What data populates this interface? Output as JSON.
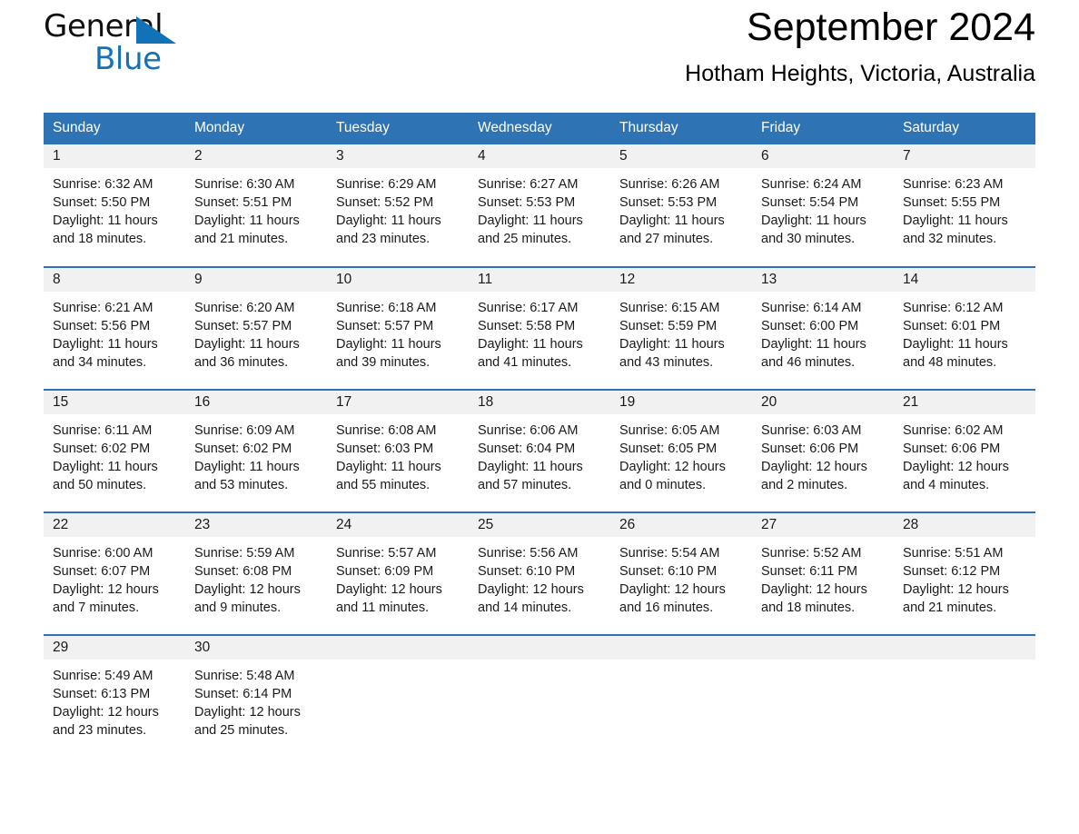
{
  "brand": {
    "name_part1": "General",
    "name_part2": "Blue",
    "triangle_color": "#1272b8"
  },
  "header": {
    "title": "September 2024",
    "location": "Hotham Heights, Victoria, Australia"
  },
  "theme": {
    "header_blue": "#2e74b5",
    "daynum_grey": "#f1f1f1",
    "text": "#1a1a1a"
  },
  "weekday_headers": [
    "Sunday",
    "Monday",
    "Tuesday",
    "Wednesday",
    "Thursday",
    "Friday",
    "Saturday"
  ],
  "weeks": [
    [
      {
        "day": "1",
        "sunrise": "Sunrise: 6:32 AM",
        "sunset": "Sunset: 5:50 PM",
        "daylight_line1": "Daylight: 11 hours",
        "daylight_line2": "and 18 minutes."
      },
      {
        "day": "2",
        "sunrise": "Sunrise: 6:30 AM",
        "sunset": "Sunset: 5:51 PM",
        "daylight_line1": "Daylight: 11 hours",
        "daylight_line2": "and 21 minutes."
      },
      {
        "day": "3",
        "sunrise": "Sunrise: 6:29 AM",
        "sunset": "Sunset: 5:52 PM",
        "daylight_line1": "Daylight: 11 hours",
        "daylight_line2": "and 23 minutes."
      },
      {
        "day": "4",
        "sunrise": "Sunrise: 6:27 AM",
        "sunset": "Sunset: 5:53 PM",
        "daylight_line1": "Daylight: 11 hours",
        "daylight_line2": "and 25 minutes."
      },
      {
        "day": "5",
        "sunrise": "Sunrise: 6:26 AM",
        "sunset": "Sunset: 5:53 PM",
        "daylight_line1": "Daylight: 11 hours",
        "daylight_line2": "and 27 minutes."
      },
      {
        "day": "6",
        "sunrise": "Sunrise: 6:24 AM",
        "sunset": "Sunset: 5:54 PM",
        "daylight_line1": "Daylight: 11 hours",
        "daylight_line2": "and 30 minutes."
      },
      {
        "day": "7",
        "sunrise": "Sunrise: 6:23 AM",
        "sunset": "Sunset: 5:55 PM",
        "daylight_line1": "Daylight: 11 hours",
        "daylight_line2": "and 32 minutes."
      }
    ],
    [
      {
        "day": "8",
        "sunrise": "Sunrise: 6:21 AM",
        "sunset": "Sunset: 5:56 PM",
        "daylight_line1": "Daylight: 11 hours",
        "daylight_line2": "and 34 minutes."
      },
      {
        "day": "9",
        "sunrise": "Sunrise: 6:20 AM",
        "sunset": "Sunset: 5:57 PM",
        "daylight_line1": "Daylight: 11 hours",
        "daylight_line2": "and 36 minutes."
      },
      {
        "day": "10",
        "sunrise": "Sunrise: 6:18 AM",
        "sunset": "Sunset: 5:57 PM",
        "daylight_line1": "Daylight: 11 hours",
        "daylight_line2": "and 39 minutes."
      },
      {
        "day": "11",
        "sunrise": "Sunrise: 6:17 AM",
        "sunset": "Sunset: 5:58 PM",
        "daylight_line1": "Daylight: 11 hours",
        "daylight_line2": "and 41 minutes."
      },
      {
        "day": "12",
        "sunrise": "Sunrise: 6:15 AM",
        "sunset": "Sunset: 5:59 PM",
        "daylight_line1": "Daylight: 11 hours",
        "daylight_line2": "and 43 minutes."
      },
      {
        "day": "13",
        "sunrise": "Sunrise: 6:14 AM",
        "sunset": "Sunset: 6:00 PM",
        "daylight_line1": "Daylight: 11 hours",
        "daylight_line2": "and 46 minutes."
      },
      {
        "day": "14",
        "sunrise": "Sunrise: 6:12 AM",
        "sunset": "Sunset: 6:01 PM",
        "daylight_line1": "Daylight: 11 hours",
        "daylight_line2": "and 48 minutes."
      }
    ],
    [
      {
        "day": "15",
        "sunrise": "Sunrise: 6:11 AM",
        "sunset": "Sunset: 6:02 PM",
        "daylight_line1": "Daylight: 11 hours",
        "daylight_line2": "and 50 minutes."
      },
      {
        "day": "16",
        "sunrise": "Sunrise: 6:09 AM",
        "sunset": "Sunset: 6:02 PM",
        "daylight_line1": "Daylight: 11 hours",
        "daylight_line2": "and 53 minutes."
      },
      {
        "day": "17",
        "sunrise": "Sunrise: 6:08 AM",
        "sunset": "Sunset: 6:03 PM",
        "daylight_line1": "Daylight: 11 hours",
        "daylight_line2": "and 55 minutes."
      },
      {
        "day": "18",
        "sunrise": "Sunrise: 6:06 AM",
        "sunset": "Sunset: 6:04 PM",
        "daylight_line1": "Daylight: 11 hours",
        "daylight_line2": "and 57 minutes."
      },
      {
        "day": "19",
        "sunrise": "Sunrise: 6:05 AM",
        "sunset": "Sunset: 6:05 PM",
        "daylight_line1": "Daylight: 12 hours",
        "daylight_line2": "and 0 minutes."
      },
      {
        "day": "20",
        "sunrise": "Sunrise: 6:03 AM",
        "sunset": "Sunset: 6:06 PM",
        "daylight_line1": "Daylight: 12 hours",
        "daylight_line2": "and 2 minutes."
      },
      {
        "day": "21",
        "sunrise": "Sunrise: 6:02 AM",
        "sunset": "Sunset: 6:06 PM",
        "daylight_line1": "Daylight: 12 hours",
        "daylight_line2": "and 4 minutes."
      }
    ],
    [
      {
        "day": "22",
        "sunrise": "Sunrise: 6:00 AM",
        "sunset": "Sunset: 6:07 PM",
        "daylight_line1": "Daylight: 12 hours",
        "daylight_line2": "and 7 minutes."
      },
      {
        "day": "23",
        "sunrise": "Sunrise: 5:59 AM",
        "sunset": "Sunset: 6:08 PM",
        "daylight_line1": "Daylight: 12 hours",
        "daylight_line2": "and 9 minutes."
      },
      {
        "day": "24",
        "sunrise": "Sunrise: 5:57 AM",
        "sunset": "Sunset: 6:09 PM",
        "daylight_line1": "Daylight: 12 hours",
        "daylight_line2": "and 11 minutes."
      },
      {
        "day": "25",
        "sunrise": "Sunrise: 5:56 AM",
        "sunset": "Sunset: 6:10 PM",
        "daylight_line1": "Daylight: 12 hours",
        "daylight_line2": "and 14 minutes."
      },
      {
        "day": "26",
        "sunrise": "Sunrise: 5:54 AM",
        "sunset": "Sunset: 6:10 PM",
        "daylight_line1": "Daylight: 12 hours",
        "daylight_line2": "and 16 minutes."
      },
      {
        "day": "27",
        "sunrise": "Sunrise: 5:52 AM",
        "sunset": "Sunset: 6:11 PM",
        "daylight_line1": "Daylight: 12 hours",
        "daylight_line2": "and 18 minutes."
      },
      {
        "day": "28",
        "sunrise": "Sunrise: 5:51 AM",
        "sunset": "Sunset: 6:12 PM",
        "daylight_line1": "Daylight: 12 hours",
        "daylight_line2": "and 21 minutes."
      }
    ],
    [
      {
        "day": "29",
        "sunrise": "Sunrise: 5:49 AM",
        "sunset": "Sunset: 6:13 PM",
        "daylight_line1": "Daylight: 12 hours",
        "daylight_line2": "and 23 minutes."
      },
      {
        "day": "30",
        "sunrise": "Sunrise: 5:48 AM",
        "sunset": "Sunset: 6:14 PM",
        "daylight_line1": "Daylight: 12 hours",
        "daylight_line2": "and 25 minutes."
      },
      {
        "day": "",
        "sunrise": "",
        "sunset": "",
        "daylight_line1": "",
        "daylight_line2": ""
      },
      {
        "day": "",
        "sunrise": "",
        "sunset": "",
        "daylight_line1": "",
        "daylight_line2": ""
      },
      {
        "day": "",
        "sunrise": "",
        "sunset": "",
        "daylight_line1": "",
        "daylight_line2": ""
      },
      {
        "day": "",
        "sunrise": "",
        "sunset": "",
        "daylight_line1": "",
        "daylight_line2": ""
      },
      {
        "day": "",
        "sunrise": "",
        "sunset": "",
        "daylight_line1": "",
        "daylight_line2": ""
      }
    ]
  ]
}
